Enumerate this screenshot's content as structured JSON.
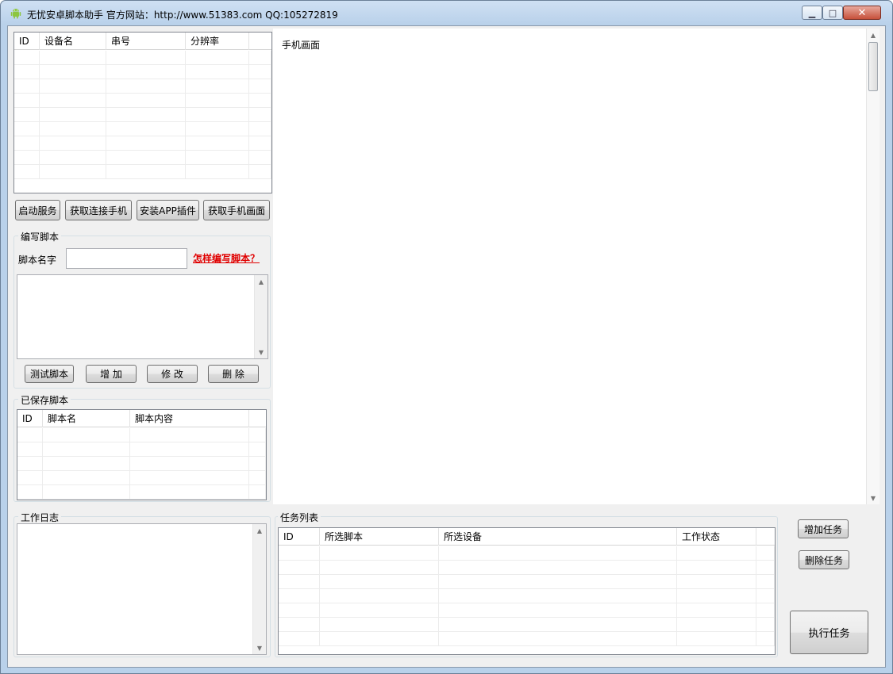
{
  "window": {
    "title": "无忧安卓脚本助手  官方网站：http://www.51383.com  QQ:105272819",
    "minimize_label": "▁",
    "maximize_label": "□",
    "close_label": "✕"
  },
  "device_table": {
    "columns": [
      "ID",
      "设备名",
      "串号",
      "分辨率"
    ],
    "rows": 9
  },
  "device_buttons": {
    "start_service": "启动服务",
    "get_phones": "获取连接手机",
    "install_plugin": "安装APP插件",
    "get_screen": "获取手机画面"
  },
  "script_editor": {
    "group_title": "编写脚本",
    "name_label": "脚本名字",
    "name_value": "",
    "help_link": "怎样编写脚本？",
    "content_value": "",
    "test_button": "测试脚本",
    "add_button": "增 加",
    "edit_button": "修 改",
    "delete_button": "删 除"
  },
  "saved_scripts": {
    "group_title": "已保存脚本",
    "columns": [
      "ID",
      "脚本名",
      "脚本内容"
    ],
    "rows": 5
  },
  "phone_screen": {
    "label": "手机画面"
  },
  "work_log": {
    "group_title": "工作日志",
    "value": ""
  },
  "task_list": {
    "group_title": "任务列表",
    "columns": [
      "ID",
      "所选脚本",
      "所选设备",
      "工作状态"
    ],
    "rows": 7,
    "add_button": "增加任务",
    "delete_button": "删除任务",
    "run_button": "执行任务"
  },
  "colors": {
    "link": "#e00000",
    "android_icon": "#8cc63f"
  },
  "icons": {
    "app": "android-icon"
  }
}
